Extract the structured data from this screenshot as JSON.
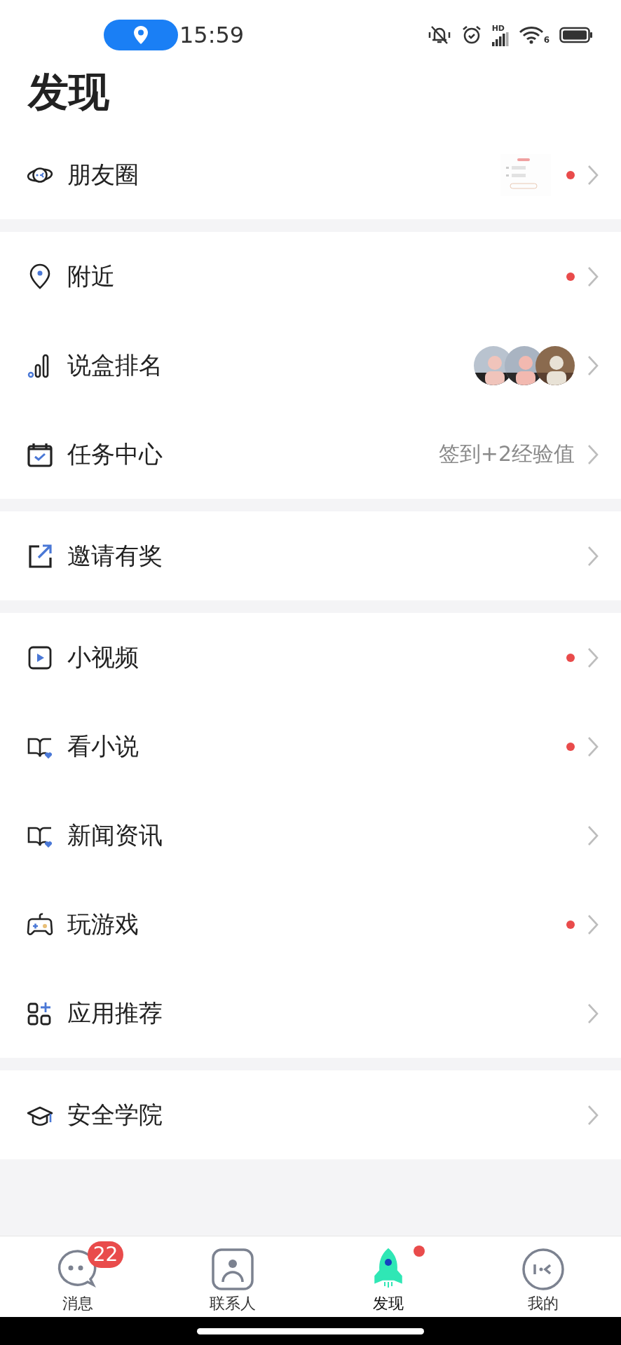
{
  "status_bar": {
    "time": "15:59",
    "signal_label": "HD",
    "wifi_label": "6"
  },
  "title": "发现",
  "sections": [
    {
      "items": [
        {
          "label": "朋友圈",
          "unread": true
        }
      ]
    },
    {
      "items": [
        {
          "label": "附近",
          "unread": true
        },
        {
          "label": "说盒排名",
          "unread": false
        },
        {
          "label": "任务中心",
          "unread": false,
          "note": "签到+2经验值"
        }
      ]
    },
    {
      "items": [
        {
          "label": "邀请有奖",
          "unread": false
        }
      ]
    },
    {
      "items": [
        {
          "label": "小视频",
          "unread": true
        },
        {
          "label": "看小说",
          "unread": true
        },
        {
          "label": "新闻资讯",
          "unread": false
        },
        {
          "label": "玩游戏",
          "unread": true
        },
        {
          "label": "应用推荐",
          "unread": false
        }
      ]
    },
    {
      "items": [
        {
          "label": "安全学院",
          "unread": false
        }
      ]
    }
  ],
  "tab_bar": [
    {
      "label": "消息",
      "selected": false,
      "badge": "22",
      "dot": false
    },
    {
      "label": "联系人",
      "selected": false,
      "dot": false
    },
    {
      "label": "发现",
      "selected": true,
      "dot": true
    },
    {
      "label": "我的",
      "selected": false,
      "dot": false
    }
  ]
}
